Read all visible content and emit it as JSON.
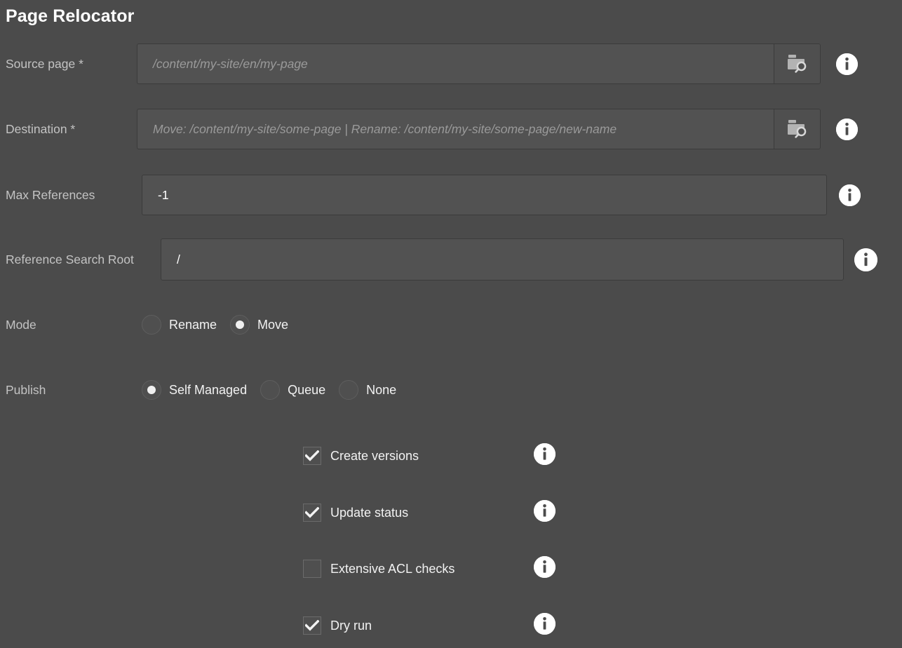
{
  "app": {
    "title": "Page Relocator",
    "background_color": "#4b4b4b",
    "field_background_color": "#525252",
    "label_color": "#c3c3c3",
    "value_color": "#ffffff",
    "placeholder_color": "#9a9a9a"
  },
  "fields": {
    "source_page": {
      "label": "Source page *",
      "placeholder": "/content/my-site/en/my-page",
      "value": "",
      "picker_icon": "folder-search-icon",
      "info_icon": "info-icon"
    },
    "destination": {
      "label": "Destination *",
      "placeholder": "Move: /content/my-site/some-page | Rename: /content/my-site/some-page/new-name",
      "value": "",
      "picker_icon": "folder-search-icon",
      "info_icon": "info-icon"
    },
    "max_references": {
      "label": "Max References",
      "placeholder": "",
      "value": "-1",
      "info_icon": "info-icon"
    },
    "reference_search_root": {
      "label": "Reference Search Root",
      "placeholder": "",
      "value": "/",
      "info_icon": "info-icon"
    }
  },
  "mode": {
    "label": "Mode",
    "options": [
      {
        "label": "Rename",
        "selected": false
      },
      {
        "label": "Move",
        "selected": true
      }
    ],
    "selected": "Move"
  },
  "publish": {
    "label": "Publish",
    "options": [
      {
        "label": "Self Managed",
        "selected": true
      },
      {
        "label": "Queue",
        "selected": false
      },
      {
        "label": "None",
        "selected": false
      }
    ],
    "selected": "Self Managed"
  },
  "checkboxes": [
    {
      "label": "Create versions",
      "checked": true,
      "info_icon": "info-icon"
    },
    {
      "label": "Update status",
      "checked": true,
      "info_icon": "info-icon"
    },
    {
      "label": "Extensive ACL checks",
      "checked": false,
      "info_icon": "info-icon"
    },
    {
      "label": "Dry run",
      "checked": true,
      "info_icon": "info-icon"
    }
  ]
}
